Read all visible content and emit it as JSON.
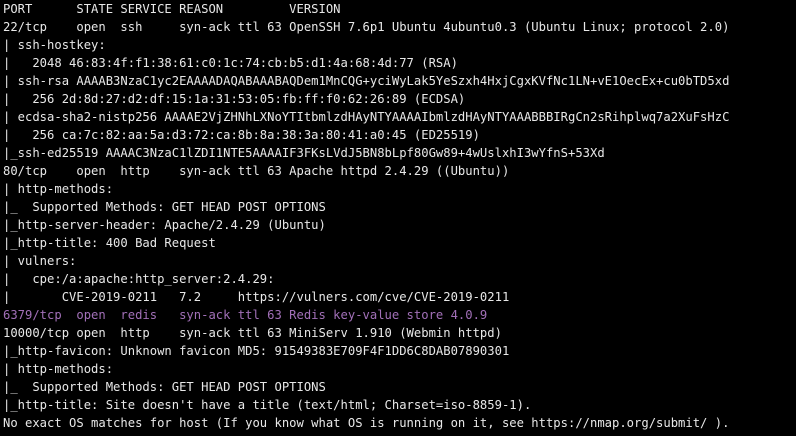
{
  "colors": {
    "background": "#000000",
    "text": "#e8e8e8",
    "highlight": "#a270b8"
  },
  "lines": [
    "PORT      STATE SERVICE REASON         VERSION",
    "22/tcp    open  ssh     syn-ack ttl 63 OpenSSH 7.6p1 Ubuntu 4ubuntu0.3 (Ubuntu Linux; protocol 2.0)",
    "| ssh-hostkey: ",
    "|   2048 46:83:4f:f1:38:61:c0:1c:74:cb:b5:d1:4a:68:4d:77 (RSA)",
    "| ssh-rsa AAAAB3NzaC1yc2EAAAADAQABAAABAQDem1MnCQG+yciWyLak5YeSzxh4HxjCgxKVfNc1LN+vE1OecEx+cu0bTD5xd",
    "|   256 2d:8d:27:d2:df:15:1a:31:53:05:fb:ff:f0:62:26:89 (ECDSA)",
    "| ecdsa-sha2-nistp256 AAAAE2VjZHNhLXNoYTItbmlzdHAyNTYAAAAIbmlzdHAyNTYAAABBBIRgCn2sRihplwq7a2XuFsHzC",
    "|   256 ca:7c:82:aa:5a:d3:72:ca:8b:8a:38:3a:80:41:a0:45 (ED25519)",
    "|_ssh-ed25519 AAAAC3NzaC1lZDI1NTE5AAAAIF3FKsLVdJ5BN8bLpf80Gw89+4wUslxhI3wYfnS+53Xd",
    "80/tcp    open  http    syn-ack ttl 63 Apache httpd 2.4.29 ((Ubuntu))",
    "| http-methods: ",
    "|_  Supported Methods: GET HEAD POST OPTIONS",
    "|_http-server-header: Apache/2.4.29 (Ubuntu)",
    "|_http-title: 400 Bad Request",
    "| vulners: ",
    "|   cpe:/a:apache:http_server:2.4.29: ",
    "|       CVE-2019-0211   7.2     https://vulners.com/cve/CVE-2019-0211",
    "6379/tcp  open  redis   syn-ack ttl 63 Redis key-value store 4.0.9",
    "10000/tcp open  http    syn-ack ttl 63 MiniServ 1.910 (Webmin httpd)",
    "|_http-favicon: Unknown favicon MD5: 91549383E709F4F1DD6C8DAB07890301",
    "| http-methods: ",
    "|_  Supported Methods: GET HEAD POST OPTIONS",
    "|_http-title: Site doesn't have a title (text/html; Charset=iso-8859-1).",
    "No exact OS matches for host (If you know what OS is running on it, see https://nmap.org/submit/ )."
  ]
}
